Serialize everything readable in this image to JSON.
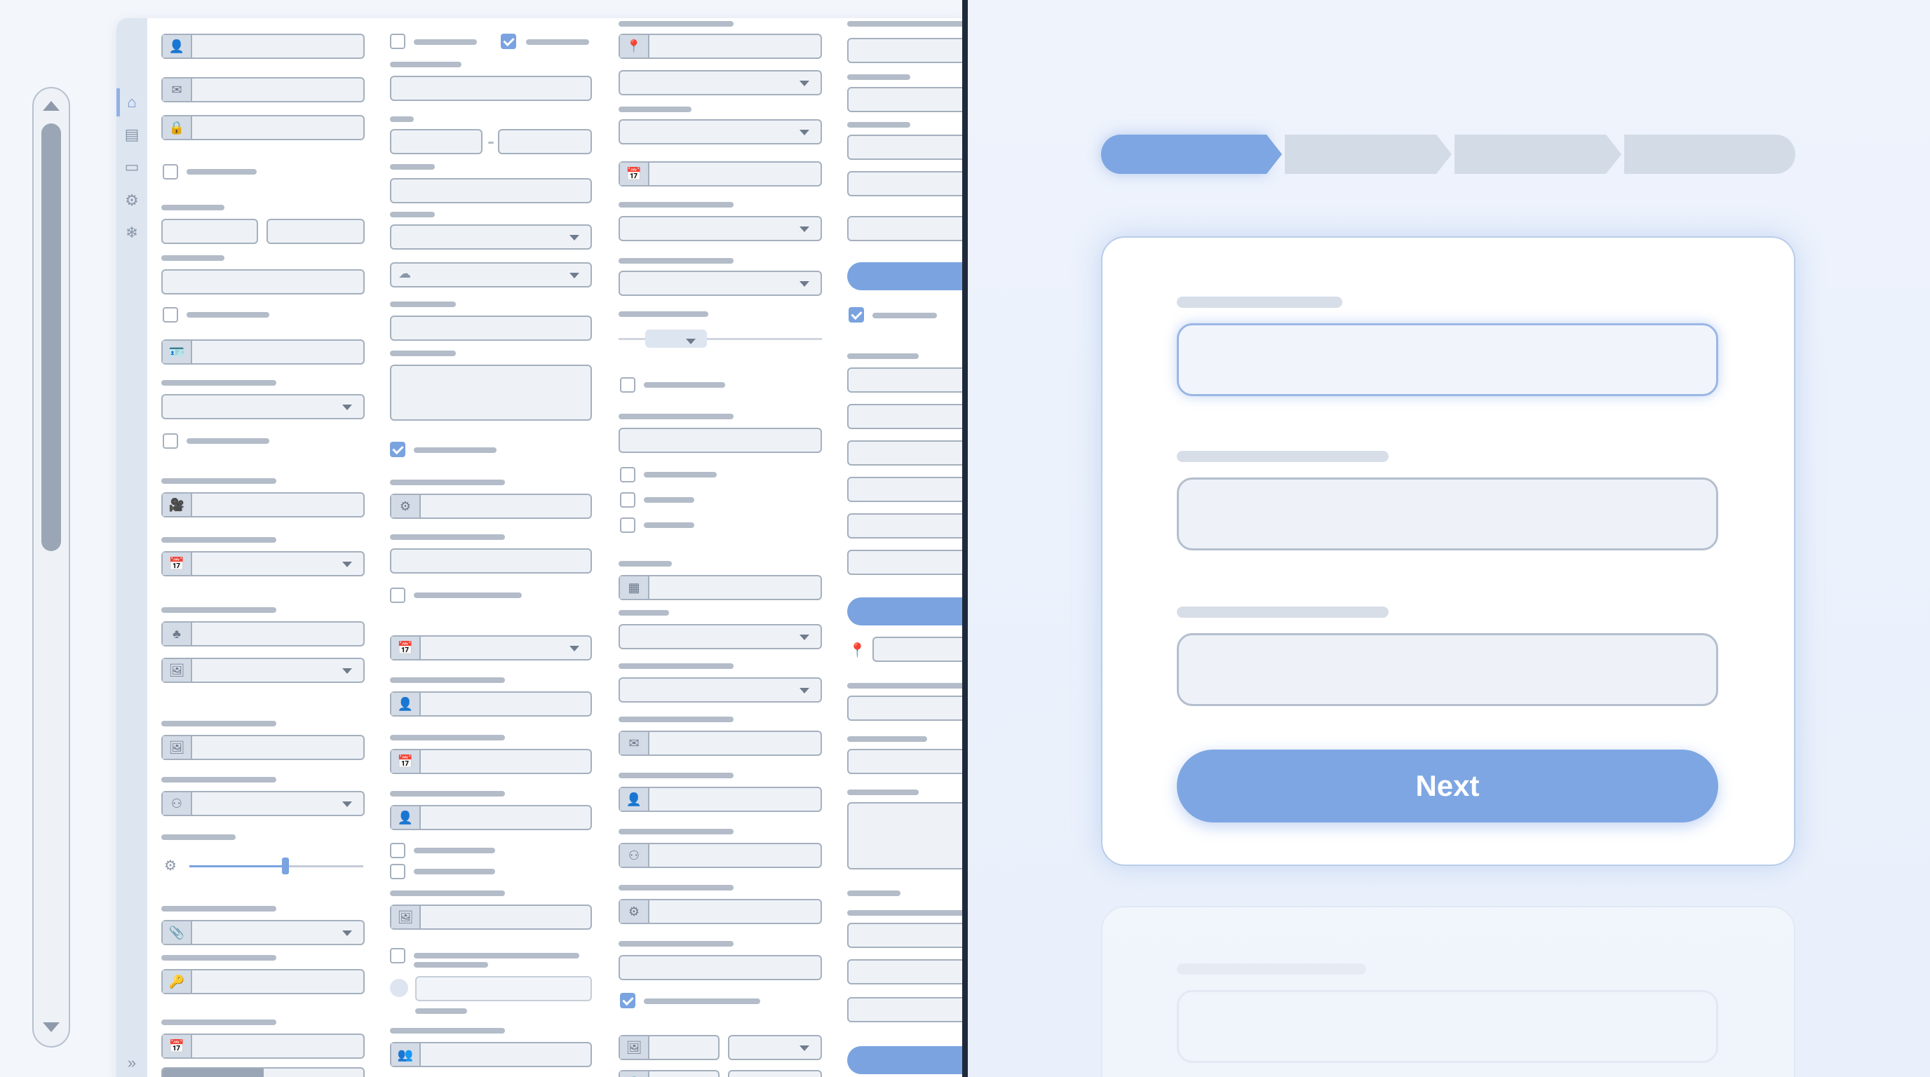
{
  "colors": {
    "accent": "#7ea6e3",
    "divider": "#1f2a3c",
    "panel_bg": "#ffffff",
    "step_inactive": "#d3dbe6"
  },
  "form_panel": {
    "rail_icons": [
      "home-icon",
      "document-icon",
      "window-icon",
      "gear-icon",
      "snowflake-icon"
    ],
    "icons": {
      "user": "👤",
      "mail": "✉",
      "lock": "🔒",
      "id_card": "🪪",
      "video": "🎥",
      "calendar": "📅",
      "tree": "♣",
      "image": "🖼",
      "network": "⚇",
      "sliders": "⚙",
      "clip": "📎",
      "key": "🔑",
      "pin": "📍",
      "grid": "▦",
      "people": "👥",
      "chevrons": "»"
    }
  },
  "stepper": {
    "steps": [
      {
        "state": "active"
      },
      {
        "state": "inactive"
      },
      {
        "state": "inactive"
      },
      {
        "state": "inactive"
      }
    ]
  },
  "wizard": {
    "next_label": "Next"
  }
}
